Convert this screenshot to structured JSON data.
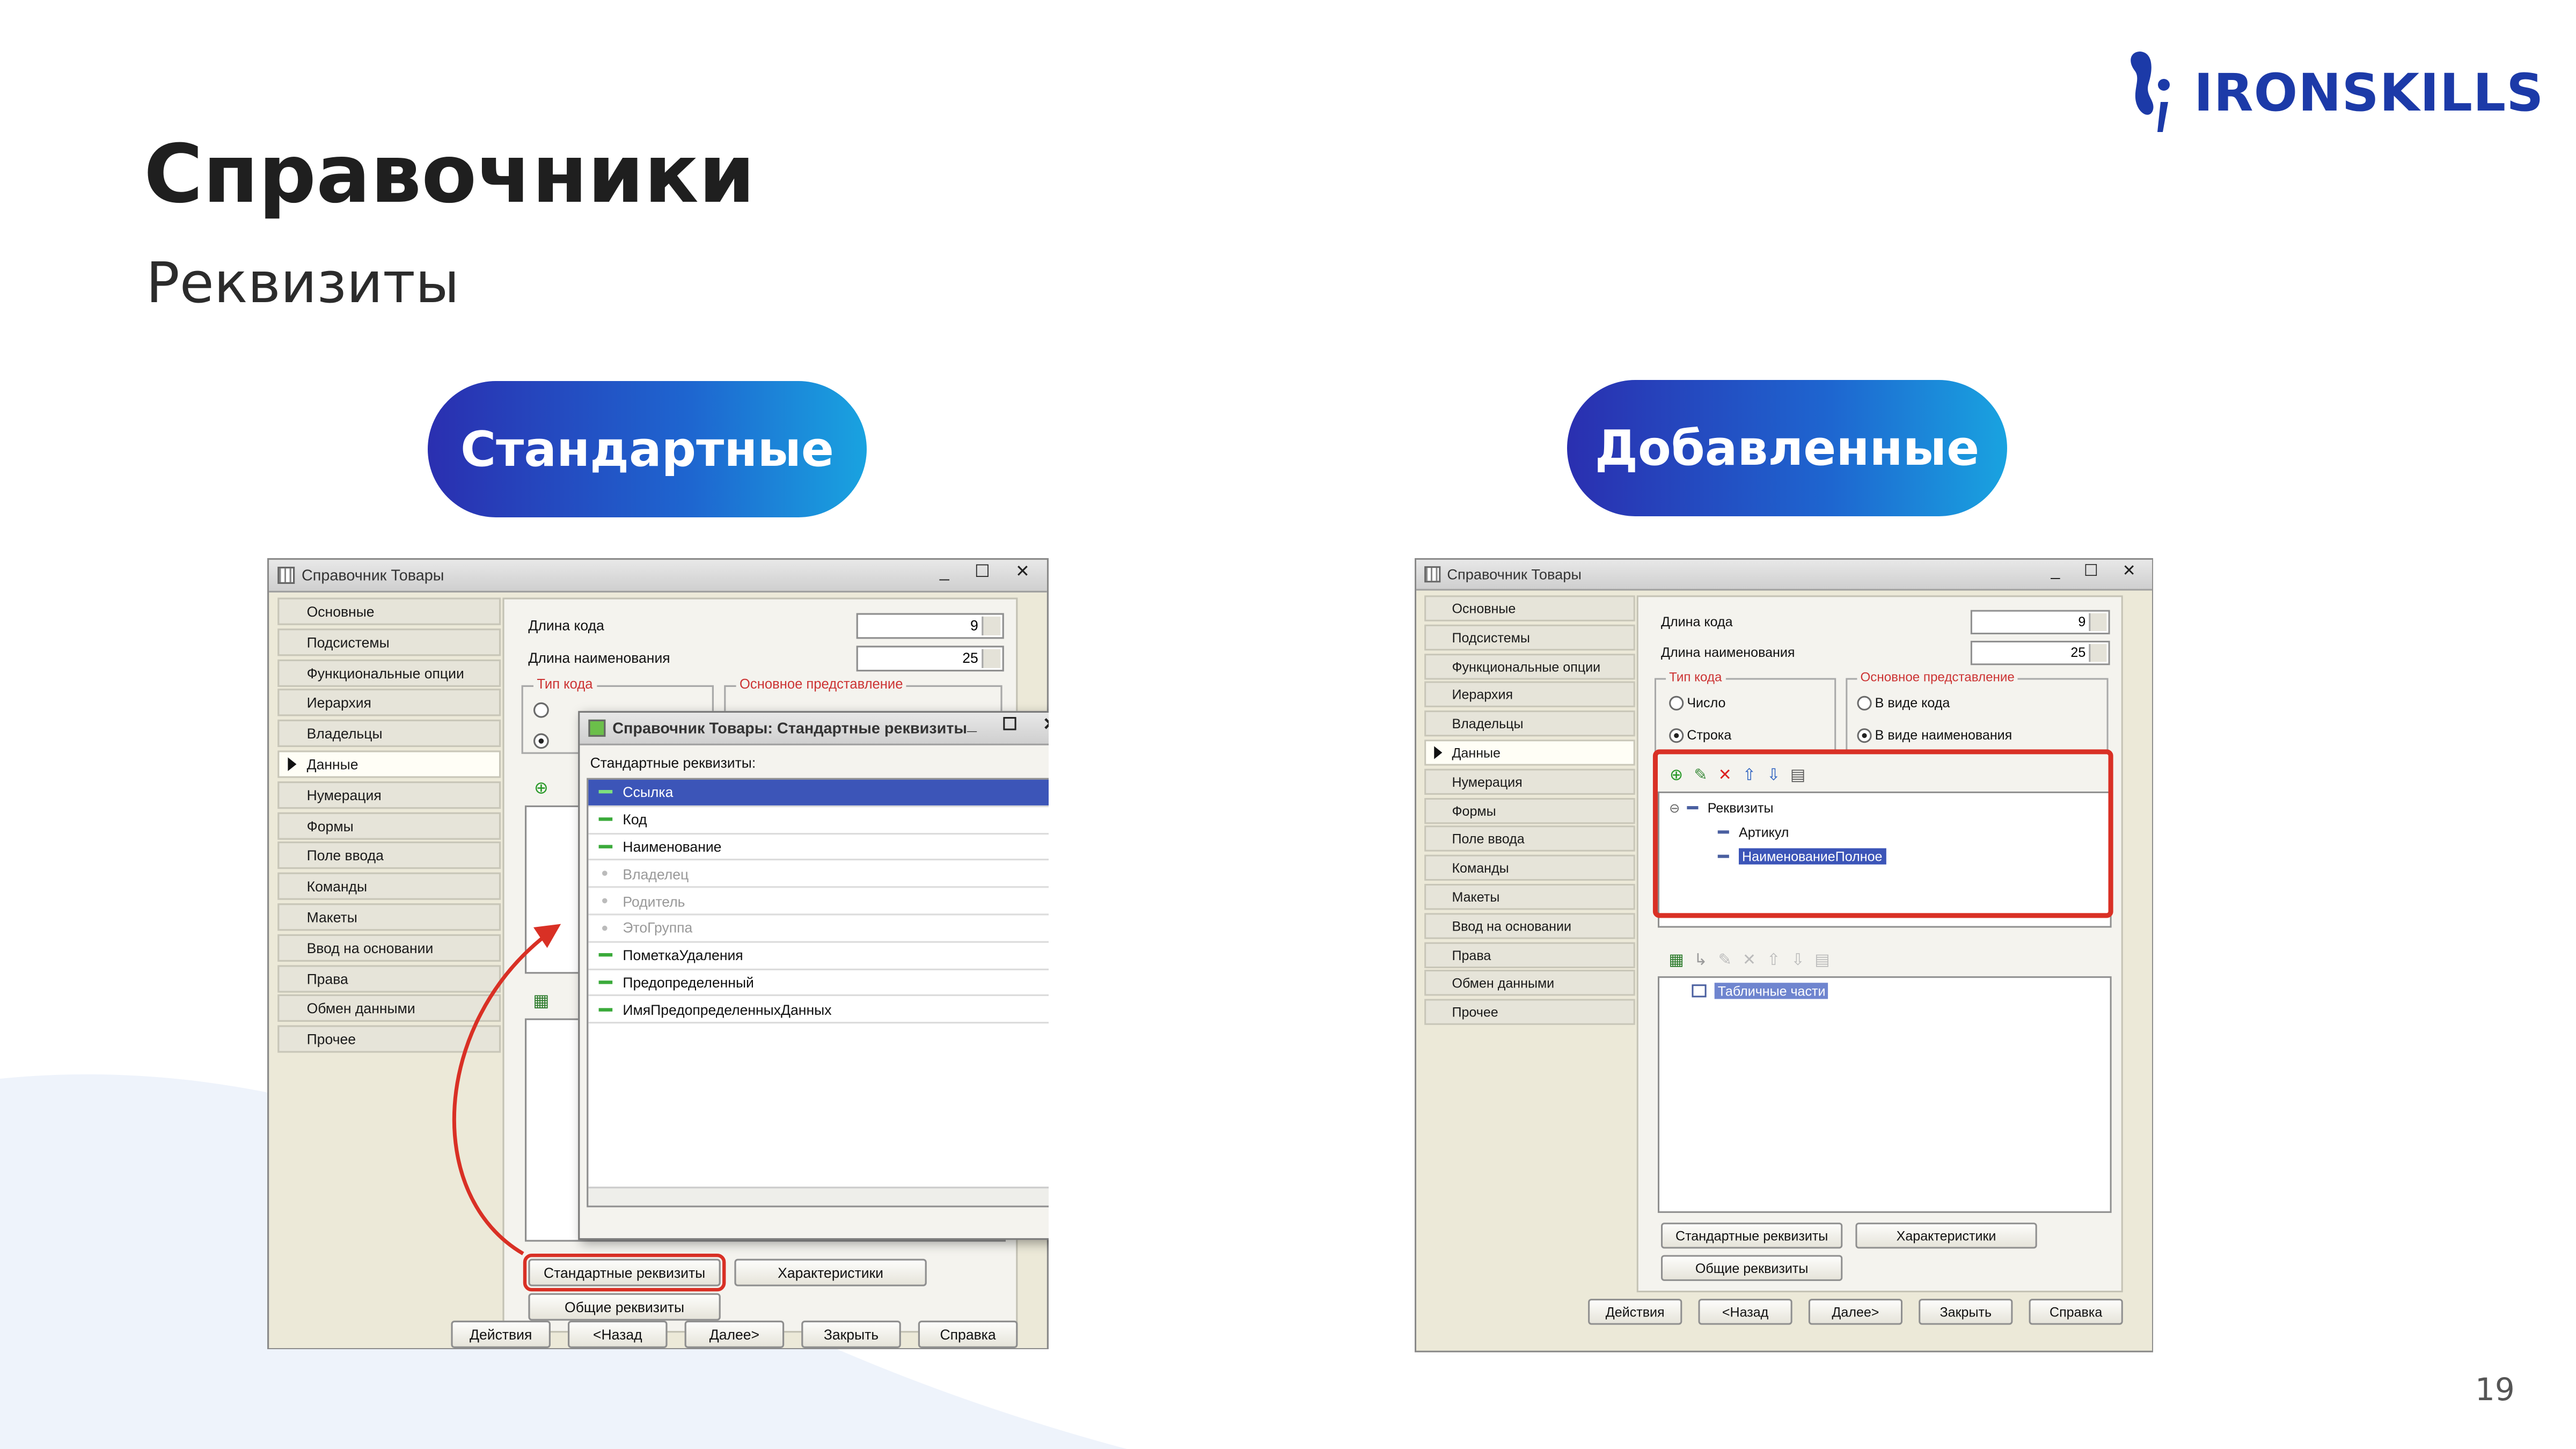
{
  "slide": {
    "title": "Справочники",
    "subtitle": "Реквизиты",
    "page_number": "19",
    "logo_text": "IRONSKILLS",
    "accent_color": "#1e4fc4",
    "highlight_color": "#d93025"
  },
  "pills": {
    "left": "Стандартные",
    "right": "Добавленные"
  },
  "window": {
    "title": "Справочник Товары",
    "nav": [
      "Основные",
      "Подсистемы",
      "Функциональные опции",
      "Иерархия",
      "Владельцы",
      "Данные",
      "Нумерация",
      "Формы",
      "Поле ввода",
      "Команды",
      "Макеты",
      "Ввод на основании",
      "Права",
      "Обмен данными",
      "Прочее"
    ],
    "active_nav": "Данные",
    "code_length_label": "Длина кода",
    "code_length_value": "9",
    "name_length_label": "Длина наименования",
    "name_length_value": "25",
    "code_type_group": "Тип кода",
    "code_type_options": [
      "Число",
      "Строка"
    ],
    "code_type_selected": "Строка",
    "main_repr_group": "Основное представление",
    "main_repr_options": [
      "В виде кода",
      "В виде наименования"
    ],
    "main_repr_selected": "В виде наименования",
    "attributes_root": "Реквизиты",
    "attributes": [
      "Артикул",
      "НаименованиеПолное"
    ],
    "selected_attribute": "НаименованиеПолное",
    "tabular_parts": "Табличные части",
    "buttons": {
      "standard_attributes": "Стандартные реквизиты",
      "characteristics": "Характеристики",
      "common_attributes": "Общие реквизиты"
    },
    "bottom_buttons": [
      "Действия",
      "<Назад",
      "Далее>",
      "Закрыть",
      "Справка"
    ]
  },
  "dialog": {
    "title": "Справочник Товары: Стандартные реквизиты",
    "list_label": "Стандартные реквизиты:",
    "items": [
      {
        "name": "Ссылка",
        "enabled": true,
        "selected": true
      },
      {
        "name": "Код",
        "enabled": true,
        "selected": false
      },
      {
        "name": "Наименование",
        "enabled": true,
        "selected": false
      },
      {
        "name": "Владелец",
        "enabled": false,
        "selected": false
      },
      {
        "name": "Родитель",
        "enabled": false,
        "selected": false
      },
      {
        "name": "ЭтоГруппа",
        "enabled": false,
        "selected": false
      },
      {
        "name": "ПометкаУдаления",
        "enabled": true,
        "selected": false
      },
      {
        "name": "Предопределенный",
        "enabled": true,
        "selected": false
      },
      {
        "name": "ИмяПредопределенныхДанных",
        "enabled": true,
        "selected": false
      }
    ]
  }
}
